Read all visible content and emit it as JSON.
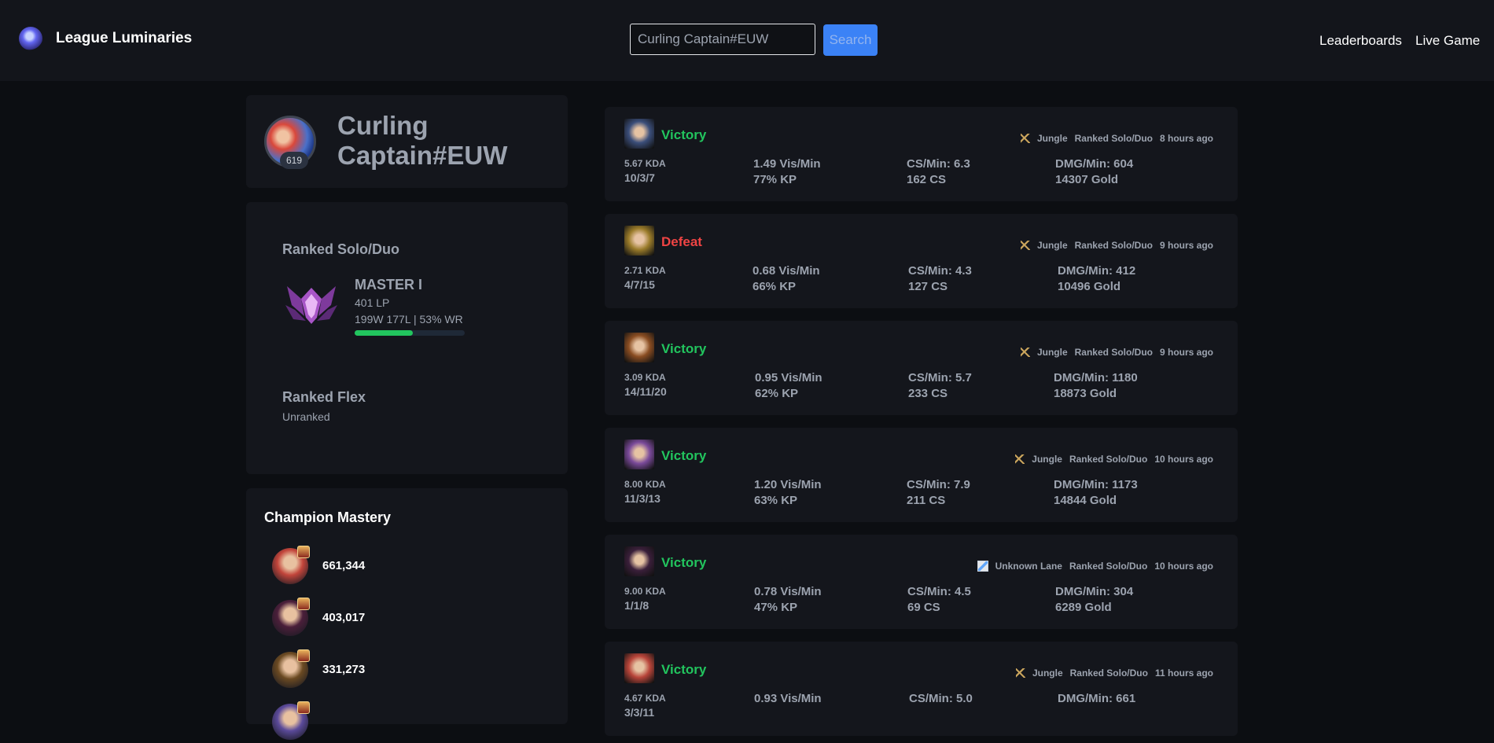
{
  "app": {
    "brand": "League Luminaries"
  },
  "search": {
    "value": "Curling Captain#EUW",
    "button_label": "Search"
  },
  "nav": {
    "leaderboards": "Leaderboards",
    "live_game": "Live Game"
  },
  "profile": {
    "name": "Curling Captain#EUW",
    "level": "619"
  },
  "ranked": {
    "solo": {
      "title": "Ranked Solo/Duo",
      "tier": "MASTER I",
      "lp": "401 LP",
      "record": "199W 177L | 53% WR",
      "winrate_fraction": 0.53
    },
    "flex": {
      "title": "Ranked Flex",
      "status": "Unranked"
    }
  },
  "mastery": {
    "title": "Champion Mastery",
    "items": [
      {
        "points": "661,344",
        "portrait": "#c2453b"
      },
      {
        "points": "403,017",
        "portrait": "#4b1f3a"
      },
      {
        "points": "331,273",
        "portrait": "#6b4a22"
      },
      {
        "points": "",
        "portrait": "#5b4a9a"
      }
    ]
  },
  "matches": [
    {
      "result": "Victory",
      "kda": "5.67 KDA",
      "kills": "10/3/7",
      "vis": "1.49 Vis/Min",
      "kp": "77% KP",
      "csmin": "CS/Min: 6.3",
      "cs": "162 CS",
      "dmg": "DMG/Min: 604",
      "gold": "14307 Gold",
      "lane": "Jungle",
      "lane_icon": "jungle-icon",
      "queue": "Ranked Solo/Duo",
      "time": "8 hours ago",
      "champ_color": "#3b4e7a"
    },
    {
      "result": "Defeat",
      "kda": "2.71 KDA",
      "kills": "4/7/15",
      "vis": "0.68 Vis/Min",
      "kp": "66% KP",
      "csmin": "CS/Min: 4.3",
      "cs": "127 CS",
      "dmg": "DMG/Min: 412",
      "gold": "10496 Gold",
      "lane": "Jungle",
      "lane_icon": "jungle-icon",
      "queue": "Ranked Solo/Duo",
      "time": "9 hours ago",
      "champ_color": "#9a7b2a"
    },
    {
      "result": "Victory",
      "kda": "3.09 KDA",
      "kills": "14/11/20",
      "vis": "0.95 Vis/Min",
      "kp": "62% KP",
      "csmin": "CS/Min: 5.7",
      "cs": "233 CS",
      "dmg": "DMG/Min: 1180",
      "gold": "18873 Gold",
      "lane": "Jungle",
      "lane_icon": "jungle-icon",
      "queue": "Ranked Solo/Duo",
      "time": "9 hours ago",
      "champ_color": "#8a4d22"
    },
    {
      "result": "Victory",
      "kda": "8.00 KDA",
      "kills": "11/3/13",
      "vis": "1.20 Vis/Min",
      "kp": "63% KP",
      "csmin": "CS/Min: 7.9",
      "cs": "211 CS",
      "dmg": "DMG/Min: 1173",
      "gold": "14844 Gold",
      "lane": "Jungle",
      "lane_icon": "jungle-icon",
      "queue": "Ranked Solo/Duo",
      "time": "10 hours ago",
      "champ_color": "#7a4a9a"
    },
    {
      "result": "Victory",
      "kda": "9.00 KDA",
      "kills": "1/1/8",
      "vis": "0.78 Vis/Min",
      "kp": "47% KP",
      "csmin": "CS/Min: 4.5",
      "cs": "69 CS",
      "dmg": "DMG/Min: 304",
      "gold": "6289 Gold",
      "lane": "Unknown Lane",
      "lane_icon": "unknown-lane-icon",
      "queue": "Ranked Solo/Duo",
      "time": "10 hours ago",
      "champ_color": "#3a1f3a"
    },
    {
      "result": "Victory",
      "kda": "4.67 KDA",
      "kills": "3/3/11",
      "vis": "0.93 Vis/Min",
      "kp": "",
      "csmin": "CS/Min: 5.0",
      "cs": "",
      "dmg": "DMG/Min: 661",
      "gold": "",
      "lane": "Jungle",
      "lane_icon": "jungle-icon",
      "queue": "Ranked Solo/Duo",
      "time": "11 hours ago",
      "champ_color": "#b8453a"
    }
  ]
}
